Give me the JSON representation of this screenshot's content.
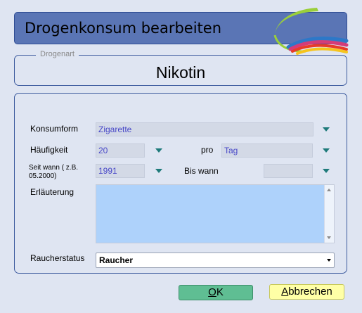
{
  "window": {
    "title": "Drogenkonsum bearbeiten"
  },
  "drug": {
    "legend": "Drogenart",
    "name": "Nikotin"
  },
  "form": {
    "konsumform": {
      "label": "Konsumform",
      "value": "Zigarette"
    },
    "haeufigkeit": {
      "label": "Häufigkeit",
      "value": "20"
    },
    "pro": {
      "label": "pro",
      "value": "Tag"
    },
    "seit_wann": {
      "label": "Seit wann ( z.B. 05.2000)",
      "value": "1991"
    },
    "bis_wann": {
      "label": "Bis wann",
      "value": ""
    },
    "erlaeuterung": {
      "label": "Erläuterung",
      "value": ""
    },
    "raucherstatus": {
      "label": "Raucherstatus",
      "value": "Raucher"
    }
  },
  "buttons": {
    "ok": {
      "mnemonic": "O",
      "rest": "K"
    },
    "cancel": {
      "mnemonic": "A",
      "rest": "bbrechen"
    }
  },
  "colors": {
    "background": "#dfe5f2",
    "title_bar": "#5a75b5",
    "field": "#d3d9e6",
    "field_text": "#4848c8",
    "textarea": "#aed2fb",
    "dropdown_arrow": "#1e7a7a",
    "ok_button": "#5fbe93",
    "cancel_button": "#ffffa6"
  },
  "icons": {
    "logo": "rainbow-swoosh-logo",
    "dropdown": "triangle-down-icon"
  }
}
